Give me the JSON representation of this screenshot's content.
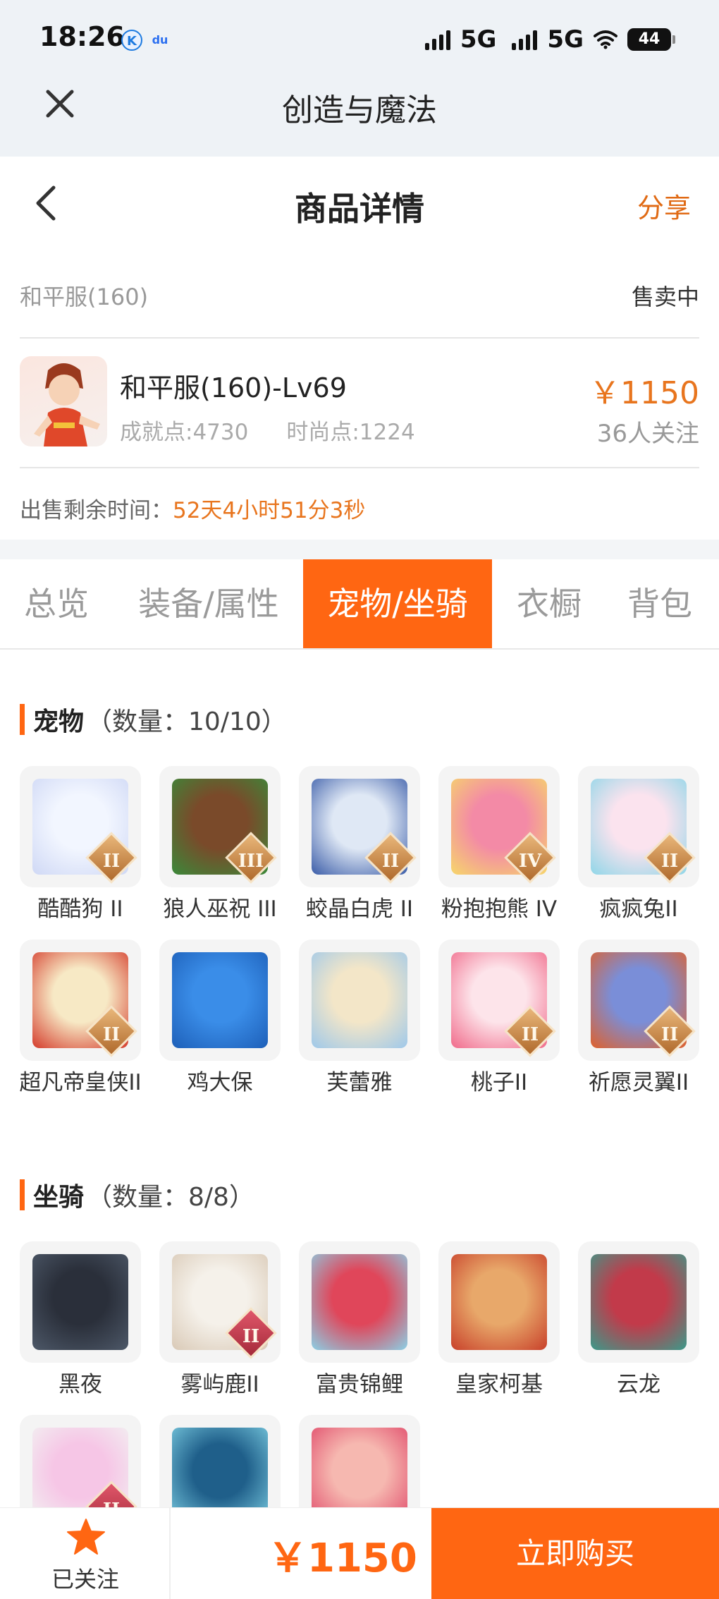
{
  "status_bar": {
    "time": "18:26",
    "app_icons": [
      "K",
      "du"
    ],
    "network1": "5G",
    "network2": "5G",
    "battery": "44"
  },
  "webview": {
    "title": "创造与魔法"
  },
  "nav": {
    "title": "商品详情",
    "share": "分享"
  },
  "product": {
    "server": "和平服(160)",
    "sale_status": "售卖中",
    "title": "和平服(160)-Lv69",
    "achievement": "成就点:4730",
    "fashion": "时尚点:1224",
    "price": "￥1150",
    "followers": "36人关注",
    "remain_label": "出售剩余时间：",
    "remain_value": "52天4小时51分3秒"
  },
  "tabs": [
    "总览",
    "装备/属性",
    "宠物/坐骑",
    "衣橱",
    "背包"
  ],
  "active_tab": 2,
  "pets": {
    "title": "宠物",
    "count": "（数量：10/10）",
    "items": [
      {
        "name": "酷酷狗 II",
        "rank": "II",
        "colors": [
          "#f2f6ff",
          "#cfd8f5"
        ]
      },
      {
        "name": "狼人巫祝 III",
        "rank": "III",
        "colors": [
          "#7a4a2a",
          "#3a8a3a"
        ]
      },
      {
        "name": "蛟晶白虎 II",
        "rank": "II",
        "colors": [
          "#dfe8f5",
          "#3a5ca8"
        ]
      },
      {
        "name": "粉抱抱熊 IV",
        "rank": "IV",
        "colors": [
          "#f38aa6",
          "#f6d76a"
        ]
      },
      {
        "name": "疯疯兔II",
        "rank": "II",
        "colors": [
          "#fbe3ee",
          "#8fd6e8"
        ]
      },
      {
        "name": "超凡帝皇侠II",
        "rank": "II",
        "colors": [
          "#f7e9c5",
          "#d43a2a"
        ]
      },
      {
        "name": "鸡大保",
        "rank": "",
        "colors": [
          "#3a8de8",
          "#1d5fb8"
        ]
      },
      {
        "name": "芙蕾雅",
        "rank": "",
        "colors": [
          "#f3e6c8",
          "#9ec8ea"
        ]
      },
      {
        "name": "桃子II",
        "rank": "II",
        "colors": [
          "#fde4ea",
          "#f06a8a"
        ]
      },
      {
        "name": "祈愿灵翼II",
        "rank": "II",
        "colors": [
          "#7a8ed8",
          "#e0602a"
        ]
      }
    ]
  },
  "mounts": {
    "title": "坐骑",
    "count": "（数量：8/8）",
    "items": [
      {
        "name": "黑夜",
        "rank": "",
        "colors": [
          "#2a2f3a",
          "#4d5868"
        ]
      },
      {
        "name": "雾屿鹿II",
        "rank": "II",
        "colors": [
          "#f5f1ea",
          "#d9c9b6"
        ]
      },
      {
        "name": "富贵锦鲤",
        "rank": "",
        "colors": [
          "#e0465a",
          "#8ad0e6"
        ]
      },
      {
        "name": "皇家柯基",
        "rank": "",
        "colors": [
          "#e8a86a",
          "#c8402a"
        ]
      },
      {
        "name": "云龙",
        "rank": "",
        "colors": [
          "#c23a4a",
          "#3a9a8a"
        ]
      },
      {
        "name": "",
        "rank": "II",
        "colors": [
          "#f6c6e6",
          "#f2f2f2"
        ]
      },
      {
        "name": "",
        "rank": "",
        "colors": [
          "#1f5f8a",
          "#7acbe0"
        ]
      },
      {
        "name": "",
        "rank": "",
        "colors": [
          "#f6b8b0",
          "#e04a6a"
        ]
      }
    ]
  },
  "bottom_bar": {
    "follow_label": "已关注",
    "price": "￥1150",
    "buy": "立即购买"
  },
  "colors": {
    "accent": "#ff6612",
    "price": "#e8751e"
  }
}
